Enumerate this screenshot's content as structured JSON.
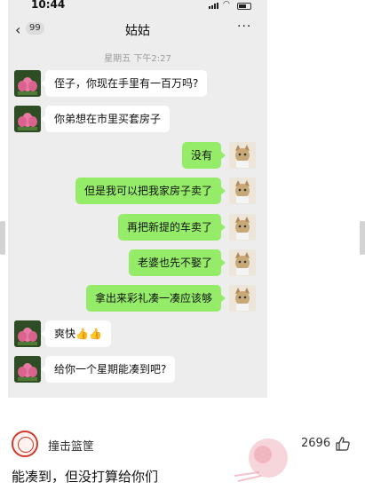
{
  "status": {
    "time": "10:44"
  },
  "nav": {
    "unread": "99",
    "title": "姑姑"
  },
  "timestamp": "星期五 下午2:27",
  "messages": [
    {
      "side": "left",
      "text": "侄子，你现在手里有一百万吗?"
    },
    {
      "side": "left",
      "text": "你弟想在市里买套房子"
    },
    {
      "side": "right",
      "text": "没有"
    },
    {
      "side": "right",
      "text": "但是我可以把我家房子卖了"
    },
    {
      "side": "right",
      "text": "再把新提的车卖了"
    },
    {
      "side": "right",
      "text": "老婆也先不娶了"
    },
    {
      "side": "right",
      "text": "拿出来彩礼凑一凑应该够"
    },
    {
      "side": "left",
      "text": "爽快👍👍"
    },
    {
      "side": "left",
      "text": "给你一个星期能凑到吧?"
    }
  ],
  "comment": {
    "username": "撞击篮筐",
    "likes": "2696",
    "text": "能凑到，但没打算给你们"
  },
  "colors": {
    "accent": "#95ec69",
    "brand": "#d23a2d"
  }
}
